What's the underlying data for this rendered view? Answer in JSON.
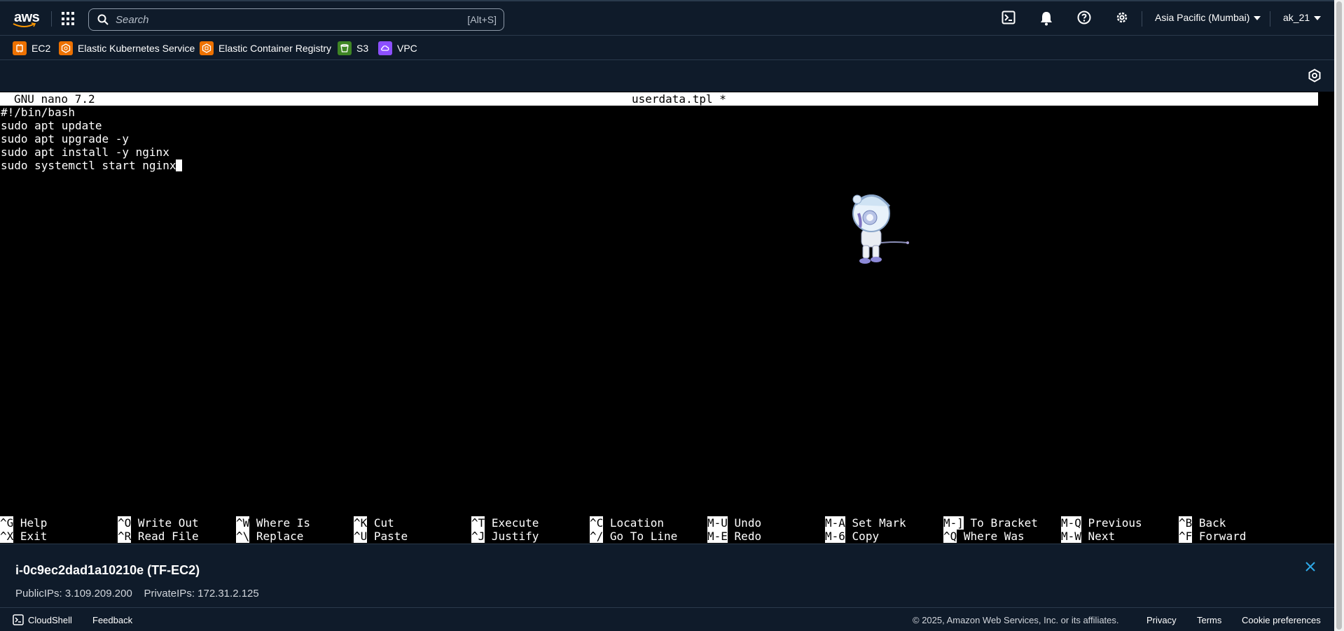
{
  "topnav": {
    "logo_text": "aws",
    "search_placeholder": "Search",
    "search_shortcut": "[Alt+S]",
    "icons": [
      "cloudshell-icon",
      "bell-icon",
      "help-icon",
      "settings-icon"
    ],
    "region": "Asia Pacific (Mumbai)",
    "user": "ak_21"
  },
  "favorites": [
    {
      "label": "EC2",
      "color": "#ed7100"
    },
    {
      "label": "Elastic Kubernetes Service",
      "color": "#ed7100"
    },
    {
      "label": "Elastic Container Registry",
      "color": "#ed7100"
    },
    {
      "label": "S3",
      "color": "#3f8624"
    },
    {
      "label": "VPC",
      "color": "#8c4fff"
    }
  ],
  "terminal": {
    "header_left": "GNU nano 7.2",
    "header_center": "userdata.tpl *",
    "lines": [
      "#!/bin/bash",
      "sudo apt update",
      "sudo apt upgrade -y",
      "sudo apt install -y nginx",
      "sudo systemctl start nginx"
    ],
    "shortcuts_row1": [
      {
        "key": "^G",
        "label": "Help"
      },
      {
        "key": "^O",
        "label": "Write Out"
      },
      {
        "key": "^W",
        "label": "Where Is"
      },
      {
        "key": "^K",
        "label": "Cut"
      },
      {
        "key": "^T",
        "label": "Execute"
      },
      {
        "key": "^C",
        "label": "Location"
      },
      {
        "key": "M-U",
        "label": "Undo"
      },
      {
        "key": "M-A",
        "label": "Set Mark"
      },
      {
        "key": "M-]",
        "label": "To Bracket"
      },
      {
        "key": "M-Q",
        "label": "Previous"
      },
      {
        "key": "^B",
        "label": "Back"
      }
    ],
    "shortcuts_row2": [
      {
        "key": "^X",
        "label": "Exit"
      },
      {
        "key": "^R",
        "label": "Read File"
      },
      {
        "key": "^\\",
        "label": "Replace"
      },
      {
        "key": "^U",
        "label": "Paste"
      },
      {
        "key": "^J",
        "label": "Justify"
      },
      {
        "key": "^/",
        "label": "Go To Line"
      },
      {
        "key": "M-E",
        "label": "Redo"
      },
      {
        "key": "M-6",
        "label": "Copy"
      },
      {
        "key": "^Q",
        "label": "Where Was"
      },
      {
        "key": "M-W",
        "label": "Next"
      },
      {
        "key": "^F",
        "label": "Forward"
      }
    ]
  },
  "instance": {
    "title": "i-0c9ec2dad1a10210e (TF-EC2)",
    "ips": "PublicIPs: 3.109.209.200    PrivateIPs: 172.31.2.125"
  },
  "footer": {
    "cloudshell": "CloudShell",
    "feedback": "Feedback",
    "copyright": "© 2025, Amazon Web Services, Inc. or its affiliates.",
    "privacy": "Privacy",
    "terms": "Terms",
    "cookies": "Cookie preferences"
  }
}
